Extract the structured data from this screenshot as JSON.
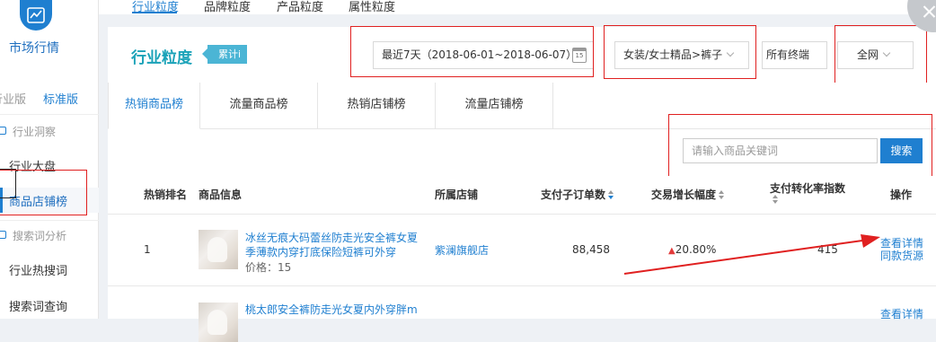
{
  "sidebar": {
    "title": "市场行情",
    "version_industry": "行业版",
    "version_standard": "标准版",
    "sections": [
      {
        "label": "行业洞察",
        "items": [
          "行业大盘",
          "商品店铺榜"
        ]
      },
      {
        "label": "搜索词分析",
        "items": [
          "行业热搜词",
          "搜索词查询"
        ]
      }
    ]
  },
  "topnav": {
    "tabs": [
      "行业粒度",
      "品牌粒度",
      "产品粒度",
      "属性粒度"
    ],
    "active": 0
  },
  "header": {
    "title": "行业粒度",
    "tag": "累计i",
    "date_range": "最近7天（2018-06-01~2018-06-07）",
    "calendar_day": "15",
    "category": "女装/女士精品>裤子",
    "terminal": "所有终端",
    "network": "全网"
  },
  "tabs": [
    "热销商品榜",
    "流量商品榜",
    "热销店铺榜",
    "流量店铺榜"
  ],
  "search": {
    "placeholder": "请输入商品关键词",
    "button": "搜索"
  },
  "table": {
    "headers": [
      "热销排名",
      "商品信息",
      "所属店铺",
      "支付子订单数",
      "交易增长幅度",
      "支付转化率指数",
      "操作"
    ],
    "rows": [
      {
        "rank": "1",
        "title_line1": "冰丝无痕大码蕾丝防走光安全裤女夏",
        "title_line2": "季薄款内穿打底保险短裤可外穿",
        "price": "价格：15",
        "shop": "紫澜旗舰店",
        "orders": "88,458",
        "growth": "20.80%",
        "conversion": "415",
        "action1": "查看详情",
        "action2": "同款货源"
      },
      {
        "rank": "",
        "title_line1": "桃太郎安全裤防走光女夏内外穿胖m",
        "title_line2": "",
        "price": "",
        "shop": "",
        "orders": "",
        "growth": "",
        "conversion": "",
        "action1": "查看详情",
        "action2": ""
      }
    ]
  },
  "colors": {
    "accent": "#1f7fd0",
    "title_teal": "#1aa2b8",
    "annotation_red": "#e02020"
  }
}
